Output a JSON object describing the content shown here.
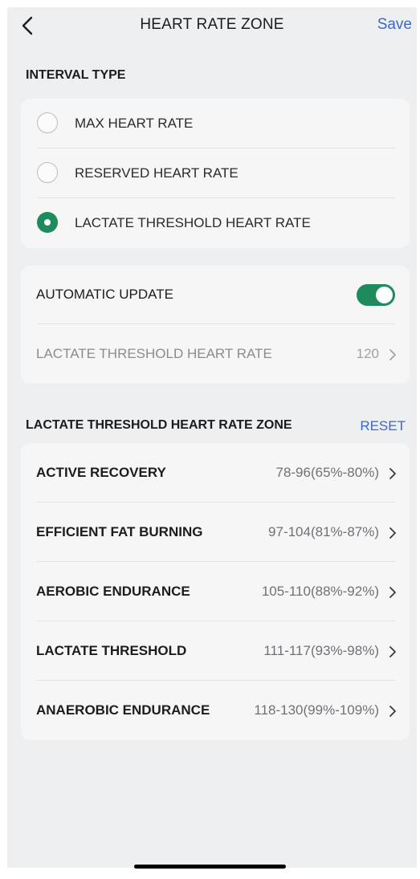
{
  "nav": {
    "back_icon": "chevron-left-icon",
    "title": "HEART RATE ZONE",
    "save_label": "Save"
  },
  "interval": {
    "section_title": "INTERVAL TYPE",
    "options": [
      {
        "label": "MAX HEART RATE",
        "selected": false
      },
      {
        "label": "RESERVED HEART RATE",
        "selected": false
      },
      {
        "label": "LACTATE THRESHOLD HEART RATE",
        "selected": true
      }
    ]
  },
  "settings": {
    "auto_update_label": "AUTOMATIC UPDATE",
    "auto_update_on": true,
    "lt_label": "LACTATE THRESHOLD HEART RATE",
    "lt_value": "120"
  },
  "zones": {
    "section_title": "LACTATE THRESHOLD HEART RATE ZONE",
    "reset_label": "RESET",
    "items": [
      {
        "label": "ACTIVE RECOVERY",
        "value": "78-96(65%-80%)"
      },
      {
        "label": "EFFICIENT FAT BURNING",
        "value": "97-104(81%-87%)"
      },
      {
        "label": "AEROBIC ENDURANCE",
        "value": "105-110(88%-92%)"
      },
      {
        "label": "LACTATE THRESHOLD",
        "value": "111-117(93%-98%)"
      },
      {
        "label": "ANAEROBIC ENDURANCE",
        "value": "118-130(99%-109%)"
      }
    ]
  },
  "colors": {
    "accent_green": "#1f8a5b",
    "link_blue": "#3f67c7",
    "background": "#eeeff1",
    "card": "#f6f6f7"
  }
}
